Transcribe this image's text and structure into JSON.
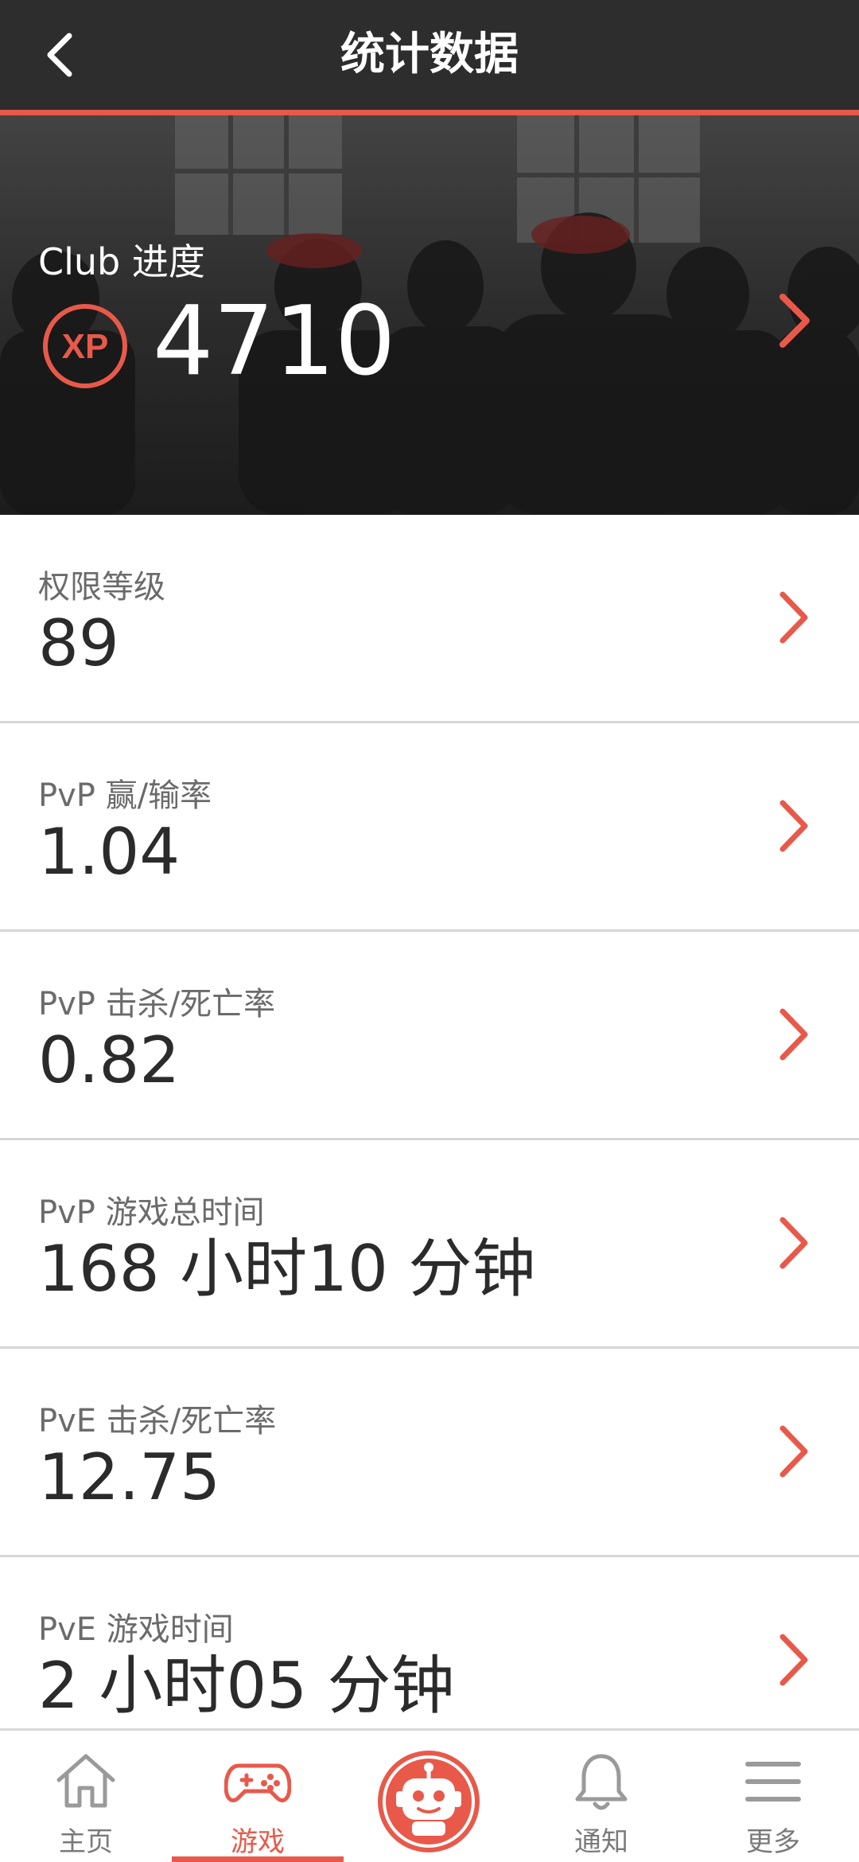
{
  "header": {
    "title": "统计数据",
    "back_icon": "chevron-left-icon"
  },
  "hero": {
    "label": "Club 进度",
    "xp_badge": "XP",
    "value": "4710",
    "chevron_icon": "chevron-right-icon"
  },
  "stats": [
    {
      "label": "权限等级",
      "value": "89"
    },
    {
      "label": "PvP 赢/输率",
      "value": "1.04"
    },
    {
      "label": "PvP 击杀/死亡率",
      "value": "0.82"
    },
    {
      "label": "PvP 游戏总时间",
      "value": "168 小时10 分钟"
    },
    {
      "label": "PvE 击杀/死亡率",
      "value": "12.75"
    },
    {
      "label": "PvE 游戏时间",
      "value": "2 小时05 分钟"
    }
  ],
  "bottom_nav": {
    "items": [
      {
        "label": "主页",
        "icon": "home-icon"
      },
      {
        "label": "游戏",
        "icon": "gamepad-icon",
        "active": true
      },
      {
        "label": "",
        "icon": "robot-icon"
      },
      {
        "label": "通知",
        "icon": "bell-icon"
      },
      {
        "label": "更多",
        "icon": "menu-icon"
      }
    ]
  },
  "colors": {
    "accent": "#e8594a",
    "topbar": "#2d2d2d",
    "divider": "#d6d6d6"
  }
}
